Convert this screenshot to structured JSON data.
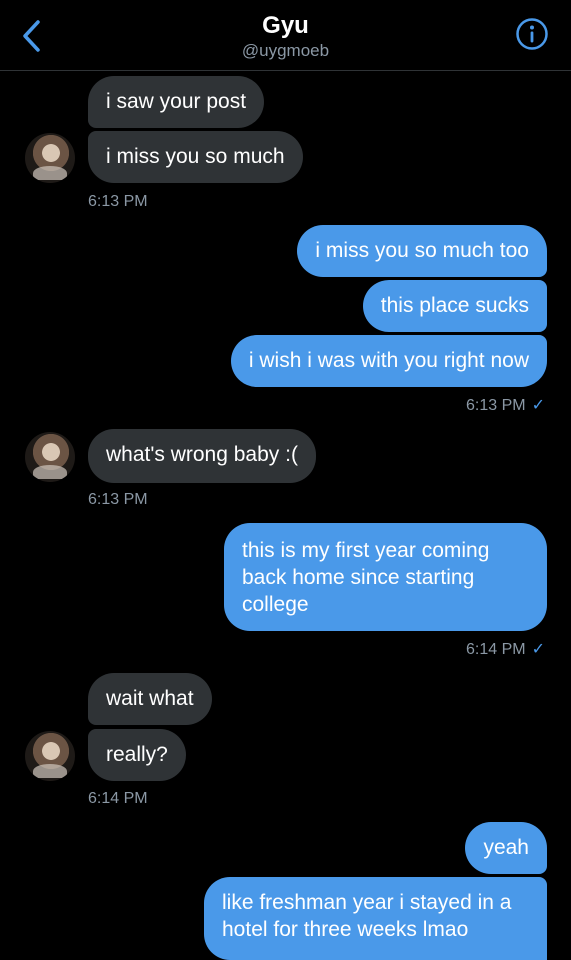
{
  "header": {
    "name": "Gyu",
    "handle": "@uygmoeb"
  },
  "messages": {
    "m1": "i saw your post",
    "m2": "i miss you so much",
    "t1": "6:13 PM",
    "m3": "i miss you so much too",
    "m4": "this place sucks",
    "m5": "i wish i was with you right now",
    "t2": "6:13 PM",
    "t2_check": "✓",
    "m6": "what's wrong baby :(",
    "t3": "6:13 PM",
    "m7": "this is my first year coming back home since starting college",
    "t4": "6:14 PM",
    "t4_check": "✓",
    "m8": "wait what",
    "m9": "really?",
    "t5": "6:14 PM",
    "m10": "yeah",
    "m11": "like freshman year i stayed in a hotel for three weeks lmao"
  },
  "colors": {
    "outgoing_bubble": "#4a99e9",
    "incoming_bubble": "#2f3336",
    "timestamp": "#8b98a5",
    "accent": "#4a99e9"
  },
  "icons": {
    "back": "chevron-left-icon",
    "info": "info-icon"
  }
}
